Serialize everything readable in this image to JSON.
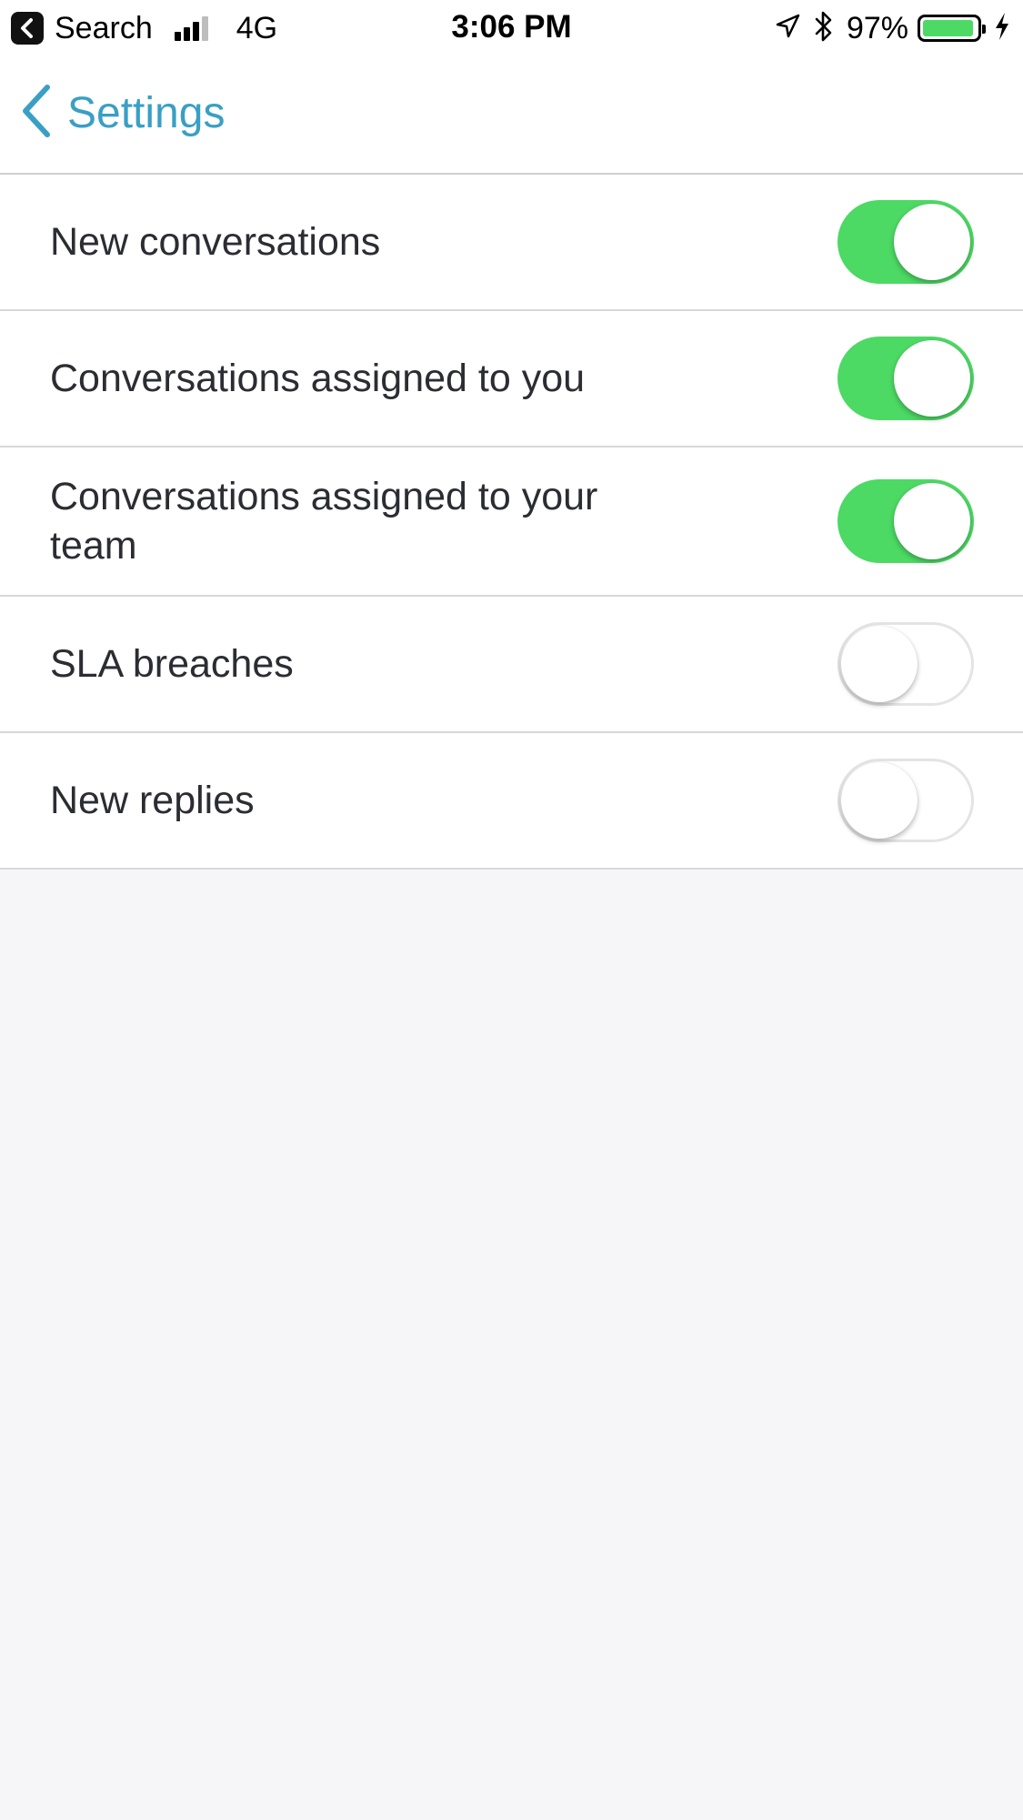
{
  "status_bar": {
    "back_app_label": "Search",
    "network": "4G",
    "time": "3:06 PM",
    "battery_percent": "97%"
  },
  "nav": {
    "back_label": "Settings"
  },
  "settings": [
    {
      "label": "New conversations",
      "enabled": true
    },
    {
      "label": "Conversations assigned to you",
      "enabled": true
    },
    {
      "label": "Conversations assigned to your team",
      "enabled": true
    },
    {
      "label": "SLA breaches",
      "enabled": false
    },
    {
      "label": "New replies",
      "enabled": false
    }
  ],
  "colors": {
    "accent": "#3a9fc4",
    "toggle_on": "#4cd964",
    "background": "#f6f6f8"
  }
}
